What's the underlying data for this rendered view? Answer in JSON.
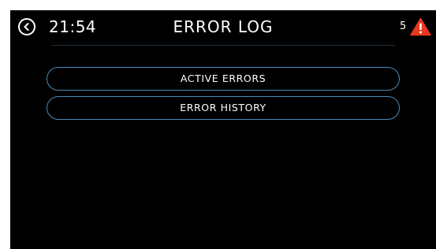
{
  "header": {
    "time": "21:54",
    "title": "ERROR LOG",
    "error_count": "5",
    "warning_icon": "warning-triangle-icon",
    "back_icon": "back-arrow-icon"
  },
  "menu": {
    "items": [
      {
        "label": "ACTIVE ERRORS"
      },
      {
        "label": "ERROR HISTORY"
      }
    ]
  },
  "colors": {
    "background": "#000000",
    "button_border": "#4a8ab5",
    "warning": "#e8391f",
    "text": "#ffffff"
  }
}
